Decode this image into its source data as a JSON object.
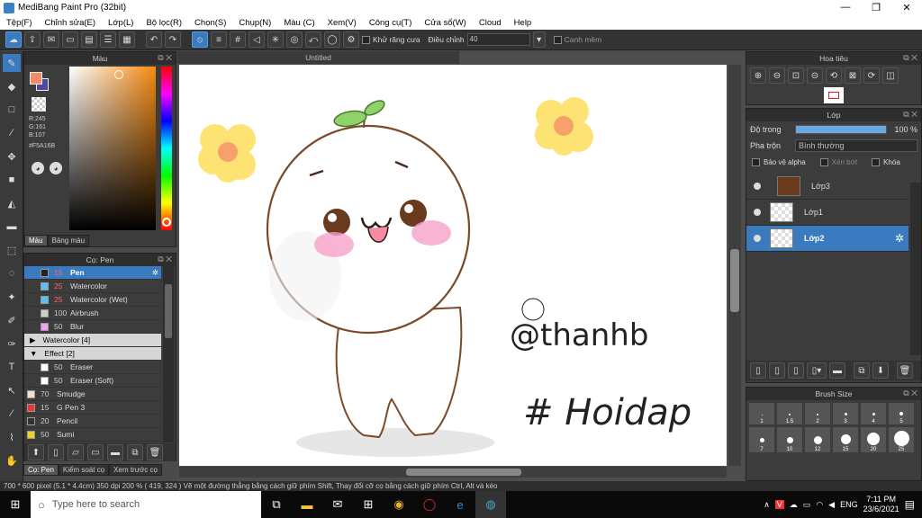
{
  "window": {
    "title": "MediBang Paint Pro (32bit)",
    "controls": [
      "—",
      "❐",
      "✕"
    ]
  },
  "menu": [
    "Tệp(F)",
    "Chỉnh sửa(E)",
    "Lớp(L)",
    "Bộ lọc(R)",
    "Chọn(S)",
    "Chụp(N)",
    "Màu (C)",
    "Xem(V)",
    "Công cụ(T)",
    "Cửa sổ(W)",
    "Cloud",
    "Help"
  ],
  "toolbar": {
    "antialias_label": "Khử răng cưa",
    "adjust_label": "Điều chỉnh",
    "adjust_value": "40",
    "smooth_label": "Canh mềm"
  },
  "color_panel": {
    "title": "Màu",
    "rgb": [
      "R:245",
      "G:161",
      "B:107"
    ],
    "hex": "#F5A16B",
    "tabs": [
      "Màu",
      "Bảng màu"
    ],
    "colors": {
      "primary": "#f5896b",
      "secondary": "#4a4aa0"
    }
  },
  "brush_panel": {
    "title": "Cọ: Pen",
    "items": [
      {
        "size": "15",
        "name": "Pen",
        "color": "#222222",
        "selected": true
      },
      {
        "size": "25",
        "name": "Watercolor",
        "color": "#5bc0f0"
      },
      {
        "size": "25",
        "name": "Watercolor (Wet)",
        "color": "#5bc0f0"
      },
      {
        "size": "100",
        "name": "Airbrush",
        "color": "#cccccc"
      },
      {
        "size": "50",
        "name": "Blur",
        "color": "#f0a0f0"
      }
    ],
    "group1": "Watercolor [4]",
    "group2": "Effect [2]",
    "effect_items": [
      {
        "size": "50",
        "name": "Eraser",
        "color": "#ffffff"
      },
      {
        "size": "50",
        "name": "Eraser (Soft)",
        "color": "#ffffff"
      }
    ],
    "other_items": [
      {
        "size": "70",
        "name": "Smudge",
        "color": "#f5ded0"
      },
      {
        "size": "15",
        "name": "G Pen 3",
        "color": "#ee3333"
      },
      {
        "size": "20",
        "name": "Pencil",
        "color": "#333333"
      },
      {
        "size": "50",
        "name": "Sumi",
        "color": "#f0d020"
      }
    ],
    "tabs": [
      "Cọ: Pen",
      "Kiểm soát cọ",
      "Xem trước cọ"
    ]
  },
  "document": {
    "tab": "Untitled",
    "handle_text": "@thanhb",
    "hashtag_text": "# Hoidap"
  },
  "navigator": {
    "title": "Hoa tiêu"
  },
  "layer_panel": {
    "title": "Lớp",
    "opacity_label": "Độ trong",
    "opacity_value": "100 %",
    "opacity": 1.0,
    "blend_label": "Pha trộn",
    "blend_value": "Bình thường",
    "protect_alpha": "Bảo vệ alpha",
    "clip": "Xén bớt",
    "lock": "Khóa",
    "layers": [
      {
        "name": "Lớp3",
        "selected": false
      },
      {
        "name": "Lớp1",
        "selected": false
      },
      {
        "name": "Lớp2",
        "selected": true
      }
    ]
  },
  "brush_size": {
    "title": "Brush Size",
    "row1": [
      "1",
      "1.5",
      "2",
      "3",
      "4",
      "5"
    ],
    "row2": [
      "7",
      "10",
      "12",
      "15",
      "20",
      "25"
    ]
  },
  "status": {
    "text": "700 * 600 pixel   (5.1 * 4.4cm)   350 dpi   200 %   ( 419, 324 )   Vẽ một đường thẳng bằng cách giữ phím Shift, Thay đổi cỡ cọ bằng cách giữ phím Ctrl, Alt và kéo"
  },
  "taskbar": {
    "search_placeholder": "Type here to search",
    "lang": "ENG",
    "time": "7:11 PM",
    "date": "23/6/2021"
  }
}
